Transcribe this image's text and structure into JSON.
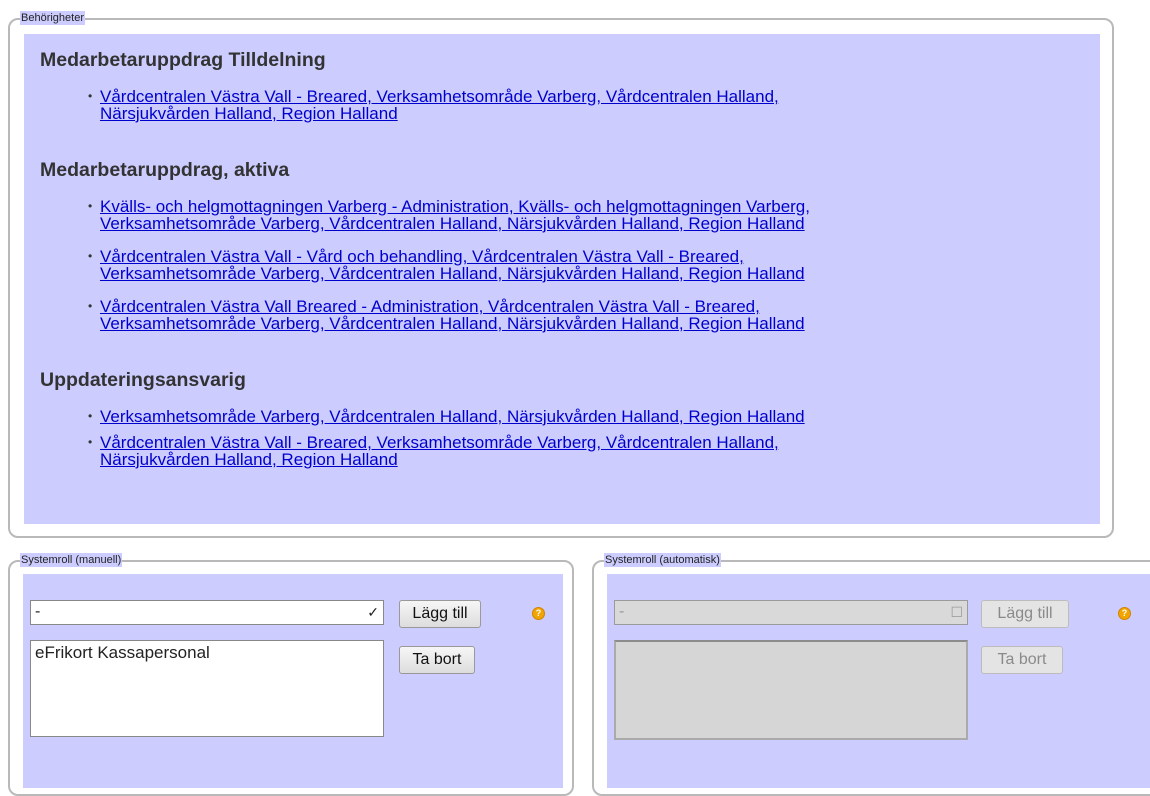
{
  "permissions": {
    "legend": "Behörigheter",
    "sections": [
      {
        "title": "Medarbetaruppdrag Tilldelning",
        "items": [
          [
            "Vårdcentralen Västra Vall - Breared, Verksamhetsområde Varberg, Vårdcentralen Halland,",
            "Närsjukvården Halland, Region Halland"
          ]
        ]
      },
      {
        "title": "Medarbetaruppdrag, aktiva",
        "items": [
          [
            "Kvälls- och helgmottagningen Varberg - Administration, Kvälls- och helgmottagningen Varberg,",
            "Verksamhetsområde Varberg, Vårdcentralen Halland, Närsjukvården Halland, Region Halland"
          ],
          [
            "Vårdcentralen Västra Vall - Vård och behandling, Vårdcentralen Västra Vall - Breared,",
            "Verksamhetsområde Varberg, Vårdcentralen Halland, Närsjukvården Halland, Region Halland"
          ],
          [
            "Vårdcentralen Västra Vall Breared - Administration, Vårdcentralen Västra Vall - Breared,",
            "Verksamhetsområde Varberg, Vårdcentralen Halland, Närsjukvården Halland, Region Halland"
          ]
        ]
      },
      {
        "title": "Uppdateringsansvarig",
        "items": [
          [
            "Verksamhetsområde Varberg, Vårdcentralen Halland, Närsjukvården Halland, Region Halland"
          ],
          [
            "Vårdcentralen Västra Vall - Breared, Verksamhetsområde Varberg, Vårdcentralen Halland,",
            "Närsjukvården Halland, Region Halland"
          ]
        ]
      }
    ]
  },
  "manual_role": {
    "legend": "Systemroll (manuell)",
    "select_value": "-",
    "add_label": "Lägg till",
    "remove_label": "Ta bort",
    "list_items": [
      "eFrikort Kassapersonal"
    ],
    "help_icon": "help-icon"
  },
  "auto_role": {
    "legend": "Systemroll (automatisk)",
    "select_value": "-",
    "add_label": "Lägg till",
    "remove_label": "Ta bort",
    "list_items": [],
    "help_icon": "help-icon"
  },
  "colors": {
    "panel_bg": "#ccccff",
    "link": "#0000cc",
    "help": "#f2a400"
  }
}
